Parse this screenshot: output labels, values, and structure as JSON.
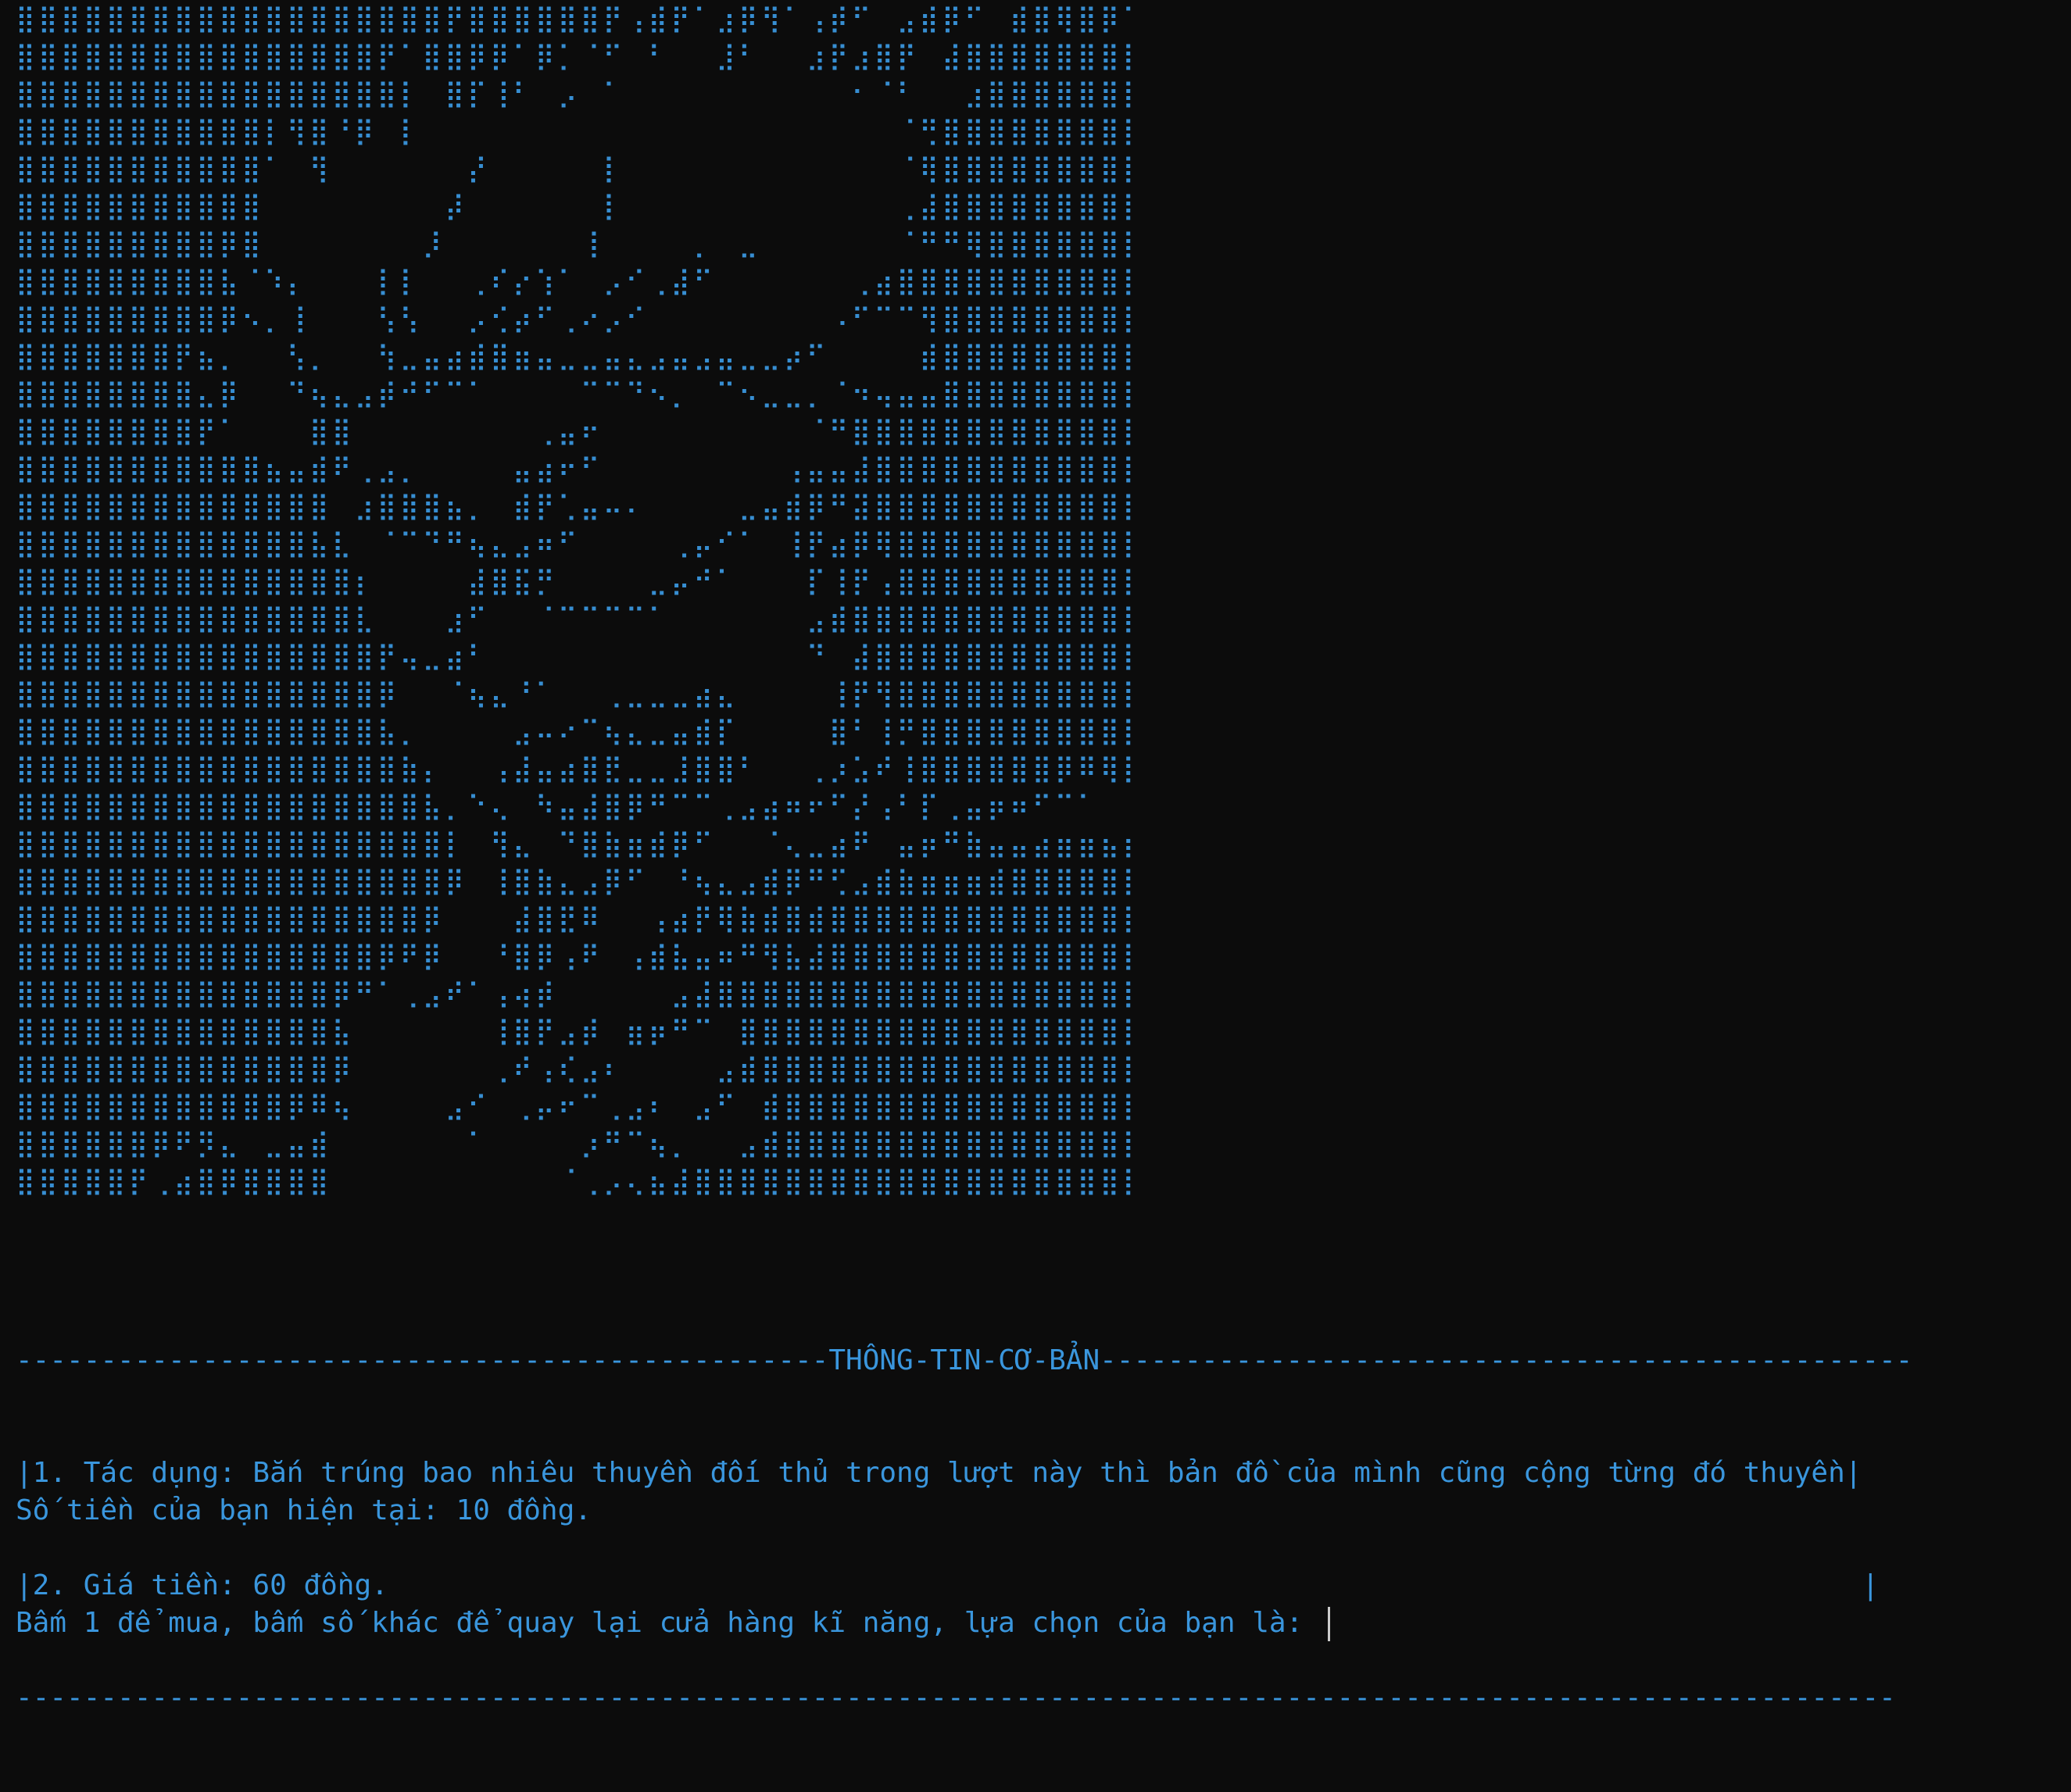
{
  "terminal": {
    "text_color": "#3a96dd",
    "background": "#0c0c0c"
  },
  "ascii_art": [
    "⣿⣿⣿⣿⣿⣿⣿⣿⣿⣿⣿⣿⣿⣿⣿⣿⣿⣿⣿⡟⣿⣿⣿⣿⣿⣿⡟⢠⣾⡟⠁⣰⡿⢻⠁⢠⡾⠋⠀⣠⣾⡿⠋⠀⣾⣿⢿⣿⡿⠁⣿⣿⣿⣿⣿⣿⣿⣿⣿⣿⣿⣿⣿⣿⣿⣿⣿",
    "⣿⣿⣿⣿⣿⣿⣿⣿⣿⣿⣿⣿⣿⣿⣿⣿⡟⠁⣿⣿⡿⡿⠁⡿⡁⠈⠋⠀⠃⠀⠀⣸⠃⠀⠀⣰⡟⣰⣿⡟⠀⣼⣿⣿⣿⣿⣿⣿⣿⣿⣿⣿⣿⣿⣿⣿⣿⣿⣿",
    "⣿⣿⣿⣿⣿⣿⣿⣿⣿⣿⣿⣿⣿⣿⣿⣿⣿⡇⠀⣿⡏⢸⠃⠀⡠⠀⠁⠀⠀⠀⠀⠀⠀⠀⠀⠀⠀⠂⠈⠃⠀⠀⣰⣿⣿⣿⣿⣿⣿⣿⣿⣿⣿⣿⣿⣿⣿⣿⣿⣿",
    "⣿⣿⣿⣿⣿⣿⣿⣿⣿⣿⣿⡇⢻⣿⠘⡿⠀⡇⠀⠀⠀⠀⠀⠀⠀⠀⠀⠀⠀⠀⠀⠀⠀⠀⠀⠀⠀⠀⠀⠈⢛⣿⣿⣿⣿⣿⣿⣿⣿⣿⣿⣿⣿⣿⣿⣿⣿⣿",
    "⣿⣿⣿⣿⣿⣿⣿⣿⣿⣿⣿⠁⠀⢻⠀⠀⠀⠀⠀⠀⡜⠀⠀⠀⠀⠀⡇⠀⠀⠀⠀⠀⠀⠀⠀⠀⠀⠀⠀⠈⢿⣿⣿⣿⣿⣿⣿⣿⣿⣿⣿⣿⣿⣿⣿⣿⣿",
    "⣿⣿⣿⣿⣿⣿⣿⣿⣿⣿⣿⠀⠀⠀⠀⠀⠀⠀⠀⡼⠀⠀⠀⠀⠀⠀⡇⠀⠀⠀⠀⠀⠀⠀⠀⠀⠀⠀⠀⢀⣼⣿⣿⣿⣿⣿⣿⣿⣿⣿⣿⣿⣿⣿⣿⣿⣿",
    "⣿⣿⣿⣿⣿⣿⣿⣿⣿⡿⣿⠀⠀⠀⠀⠀⠀⠀⡸⠀⠀⠀⠀⠀⠀⢸⠀⠀⠀⠀⡀⠀⣀⠀⠀⠀⠀⠀⠀⠈⠛⠛⢿⣿⣿⣿⣿⣿⣿⣿⣿⣿⣿⣿⣿⣿⣿",
    "⣿⣿⣿⣿⣿⣿⣿⣿⣿⣧⠈⠱⡄⠀⠀⠀⡇⡇⠀⠀⢀⠎⡔⢱⠁⠀⡠⠊⢀⣼⠋⠀⠀⠀⠀⠀⠀⢀⣴⣿⣿⣿⣿⣿⣿⣿⣿⣿⣿⣿⣿⣿⣿⣿⣿",
    "⣿⣿⣿⣿⣿⣿⣿⣿⣿⡿⠢⡀⢸⠀⠀⠀⢣⢣⠀⠀⡠⢊⡴⠋⢀⠔⡠⠊⠀⠀⠀⠀⠀⠀⠀⠀⠠⠋⠉⠉⢻⣿⣿⣿⣿⣿⣿⣿⣿⣿⣿⣿⣿⣿⣿",
    "⣿⣿⣿⣿⣿⣿⣿⡟⣦⡀⠀⠀⢣⡀⠀⠀⢳⣀⣤⣴⣾⣿⣶⣤⣀⣀⣤⣄⣠⣤⣠⣤⣀⣀⡴⠋⠀⠀⠀⠀⣾⣿⣿⣿⣿⣿⣿⣿⣿⣿⣿⣿⣿⣿⣿",
    "⣿⣿⣿⣿⣿⣿⣿⣿⣄⡿⠀⠀⠙⢦⣄⣠⡾⠚⠋⠉⠁⠀⠀⠀⠀⠉⠉⠙⠢⡀⠀⠉⠢⣀⣀⡀⠈⠲⢤⣤⣤⣿⣿⣿⣿⣿⣿⣿⣿⣿⣿⣿⣿⣿",
    "⣿⣿⣿⣿⣿⣿⣿⣿⡟⠁⠀⠀⠀⣿⣿⠀⠀⠀⠀⠀⠀⠀⠀⢀⣤⠖⠀⠀⠀⠀⠀⠀⠀⠀⠀⠈⠛⣿⣿⣿⣿⣿⣿⣿⣿⣿⣿⣿⣿⣿⣿⣿⣿",
    "⣿⣿⣿⣿⣿⣿⣿⣿⣿⣿⣿⣦⣤⣾⠟⢀⣠⡀⠀⠀⠀⠀⣤⣴⠖⠋⠀⠀⠀⠀⠀⠀⠀⠀⢠⣤⣤⣼⣿⣿⣿⣿⣿⣿⣿⣿⣿⣿⣿⣿⣿⣿⣿",
    "⣿⣿⣿⣿⣿⣿⣿⣿⣿⣿⣿⣿⣿⣿⠀⣰⣿⣿⣿⣦⡀⠀⣾⡟⢁⣤⠤⠄⠀⠀⠀⠀⣀⣤⣾⡿⠛⣽⣿⣿⣿⣿⣿⣿⣿⣿⣿⣿⣿⣿⣿⣿⣿",
    "⣿⣿⣿⣿⣿⣿⣿⣿⣿⣿⣿⣿⣿⣧⣇⠀⠈⠉⠙⠛⢦⣄⣠⠶⠋⠀⠀⠀⠀⢀⡤⠊⠁⠀⢸⡟⣴⡿⢿⣿⣿⣿⣿⣿⣿⣿⣿⣿⣿⣿⣿⣿⣿",
    "⣿⣿⣿⣿⣿⣿⣿⣿⣿⣿⣿⣿⣿⣿⣿⡆⠀⠀⠀⠀⣼⣿⣯⡛⠀⠀⠀⠀⣀⡤⠚⠁⠀⠀⠀⡏⢸⡟⢠⣿⣿⣿⣿⣿⣿⣿⣿⣿⣿⣿⣿⣿⣿",
    "⣿⣿⣿⣿⣿⣿⣿⣿⣿⣿⣿⣿⣿⣿⣿⣇⠀⠀⠀⣰⠋⠀⠀⠈⠉⠉⠉⠉⠁⠀⠀⠀⠀⠀⠀⣠⣾⣿⣿⣿⣿⣿⣿⣿⣿⣿⣿⣿⣿⣿⣿⣿⣿",
    "⣿⣿⣿⣿⣿⣿⣿⣿⣿⣿⣿⣿⣿⣿⣿⣿⡟⢤⣀⣴⠃⠀⠀⠀⠀⠀⠀⠀⠀⠀⠀⠀⠀⠀⠀⠙⠀⣼⣿⣿⣿⣿⣿⣿⣿⣿⣿⣿⣿⣿⣿⣿⣿",
    "⣿⣿⣿⣿⣿⣿⣿⣿⣿⣿⣿⣿⣿⣿⣿⣿⡿⠀⠀⠈⢦⣄⠘⠁⠀⠀⢀⣀⣀⣀⣴⣄⠀⠀⠀⠀⢸⡟⢻⣿⣿⣿⣿⣿⣿⣿⣿⣿⣿⣿⣿⣿⣿",
    "⣿⣿⣿⣿⣿⣿⣿⣿⣿⣿⣿⣿⣿⣿⣿⣿⣧⡀⠀⠀⠀⠀⣠⠤⠔⠉⢦⣄⣀⣤⣾⡏⠀⠀⠀⠀⣿⠃⢸⡛⣿⣿⣿⣿⣿⣿⣿⣿⣿⣿⣿⣿⣿",
    "⣿⣿⣿⣿⣿⣿⣿⣿⣿⣿⣿⣿⣿⣿⣿⣿⣿⣷⡄⠀⠀⢠⣼⣤⣴⣿⣟⣀⣀⣸⣿⣿⠃⠀⠀⢀⡰⣡⠞⢸⣿⣿⣿⣿⣿⣿⡿⠿⢿⡿⣿⣿⣿⣿",
    "⣿⣿⣿⣿⣿⣿⣿⣿⣿⣿⣿⣿⣿⣿⣿⣿⣿⣿⣧⡀⠑⢄⠀⠳⣤⣼⣿⡿⠛⠉⠉⢀⣠⣴⠶⠖⠋⡜⢠⠃⡏⢀⣤⡶⠶⠋⠉⠁⠀⠀⠀⠀⢠⣼⣿⣿⣿",
    "⣿⣿⣿⣿⣿⣿⣿⣿⣿⣿⣿⣿⣿⣿⣿⣿⣿⣿⣿⡇⠀⢻⣄⠀⠙⣿⣷⣶⣾⡿⠋⠀⠀⠈⢄⣀⣴⠟⠀⣤⡶⠛⣷⣤⣤⣴⣶⣶⣦⣶⡆⠀⠀⠈⣿⣿⣿⣿⣿",
    "⣿⣿⣿⣿⣿⣿⣿⣿⣿⣿⣿⣿⣿⣿⣿⣿⣿⣿⣿⡿⠀⢸⣿⣷⣄⣠⡿⠋⠀⠘⢦⣄⣠⣾⡿⠛⢋⣠⣾⣷⣶⣶⣶⣾⣿⣿⣿⣿⣿⣿⣷⣦⣀⣴⣄⣿⣿⣿⣿",
    "⣿⣿⣿⣿⣿⣿⣿⣿⣿⣿⣿⣿⣿⣿⣿⣿⣿⣿⡿⠀⠀⠀⣼⣿⣟⠿⠀⠀⢠⣴⡟⢿⣷⣾⣿⣾⣿⣿⣿⣿⣿⣿⣿⣿⣿⣿⣿⣿⣿⣿⣿⣿⣿⣿⣿⣿⣿",
    "⣿⣿⣿⣿⣿⣿⣿⣿⣿⣿⣿⣿⣿⣿⣿⣿⡿⠟⡿⠀⠀⠘⣿⡿⢠⠟⠀⢠⣾⣧⣤⠶⠛⢻⣧⣼⣿⣿⣿⣿⣿⣿⣿⣿⣿⣿⣿⣿⣿⣿⣷⣶⠶⢿⣿⣿⣿⣿",
    "⣿⣿⣿⣿⣿⣿⣿⣿⣿⣿⣿⣿⣿⣿⡿⠛⠁⢀⣠⠞⠁⢠⢴⡾⠀⠀⠀⠀⠀⣠⣼⣿⣿⣿⣿⣿⣿⣿⣿⣿⣿⣿⣿⣿⣿⣿⣿⣿⣿⣷⣄⣤⣿⣿⣿⣿⣿",
    "⣿⣿⣿⣿⣿⣿⣿⣿⣿⣿⣿⣿⣿⣿⣧⠀⠀⠀⠀⠀⠀⢸⣿⡟⣠⡾⠀⣶⡶⠛⠉⠀⣿⣿⣿⣿⣿⣿⣿⣿⣿⣿⣿⣿⣿⣿⣿⣿⣿⣷⣦⣤⣀⣀⠀⠀⠘⠛",
    "⣿⣿⣿⣿⣿⣿⣿⣿⣿⣿⣿⣿⣿⣿⡿⠀⠀⠀⠀⠀⠀⢀⠞⢠⢎⣠⠆⠀⠀⠀⠀⣠⣾⣿⣿⣿⣿⣿⣿⣿⣿⣿⣿⣿⣿⣿⣿⣿⣿⣿⣿⣿⣯⣤⣤⣿⣿⣿",
    "⣿⣿⣿⣿⣿⣿⣿⣿⣿⣿⣿⣿⡿⠿⢦⠀⠀⠀⠀⣠⠊⠀⢀⡤⠖⠉⢀⣠⠆⠀⣠⠋⠀⣾⣿⣿⣿⣿⣿⣿⣿⣿⣿⣿⣿⣿⣿⣿⣿⣿⣿⣿⣿⣿⣿⣿⣿",
    "⣿⣿⣿⣿⣿⣿⡿⠟⡻⣄⠀⣀⣤⣾⠀⠀⠀⠀⠀⠀⠁⠀⠀⠀⠀⡰⠛⠉⢦⡀⠀⠀⣠⣾⣿⣿⣿⣿⣿⣿⣿⣿⣿⣿⣿⣿⣿⣿⣿⣿⣿⣿⣿⣿⣿⣿⣿",
    "⣿⣿⣿⣿⣿⡟⢀⣴⣿⡿⣿⣿⣿⣿⠀⠀⠀⠀⠀⠀⠀⠀⠀⠀⠈⢀⡠⢄⣦⣼⣿⣿⣿⣿⣿⣿⣿⣿⣿⣿⣿⣿⣿⣿⣿⣿⣿⣿⣿⣿⣿⣿⣿⣿⣿⣿⣿"
  ],
  "info_box": {
    "top_border": "------------------------------------------------THÔNG-TIN-CƠ-BẢN------------------------------------------------",
    "line1": "|1. Tác dụng: Bắn trúng bao nhiêu thuyền đối thủ trong lượt này thì bản đồ của mình cũng cộng từng đó thuyền|",
    "line2": "|2. Giá tiền: 60 đồng.                                                                                       |",
    "bottom_border": "---------------------------------------------------------------------------------------------------------------"
  },
  "prompt": {
    "balance": "Số tiền của bạn hiện tại: 10 đồng.",
    "question": "Bấm 1 để mua, bấm số khác để quay lại cửa hàng kĩ năng, lựa chọn của bạn là: "
  }
}
